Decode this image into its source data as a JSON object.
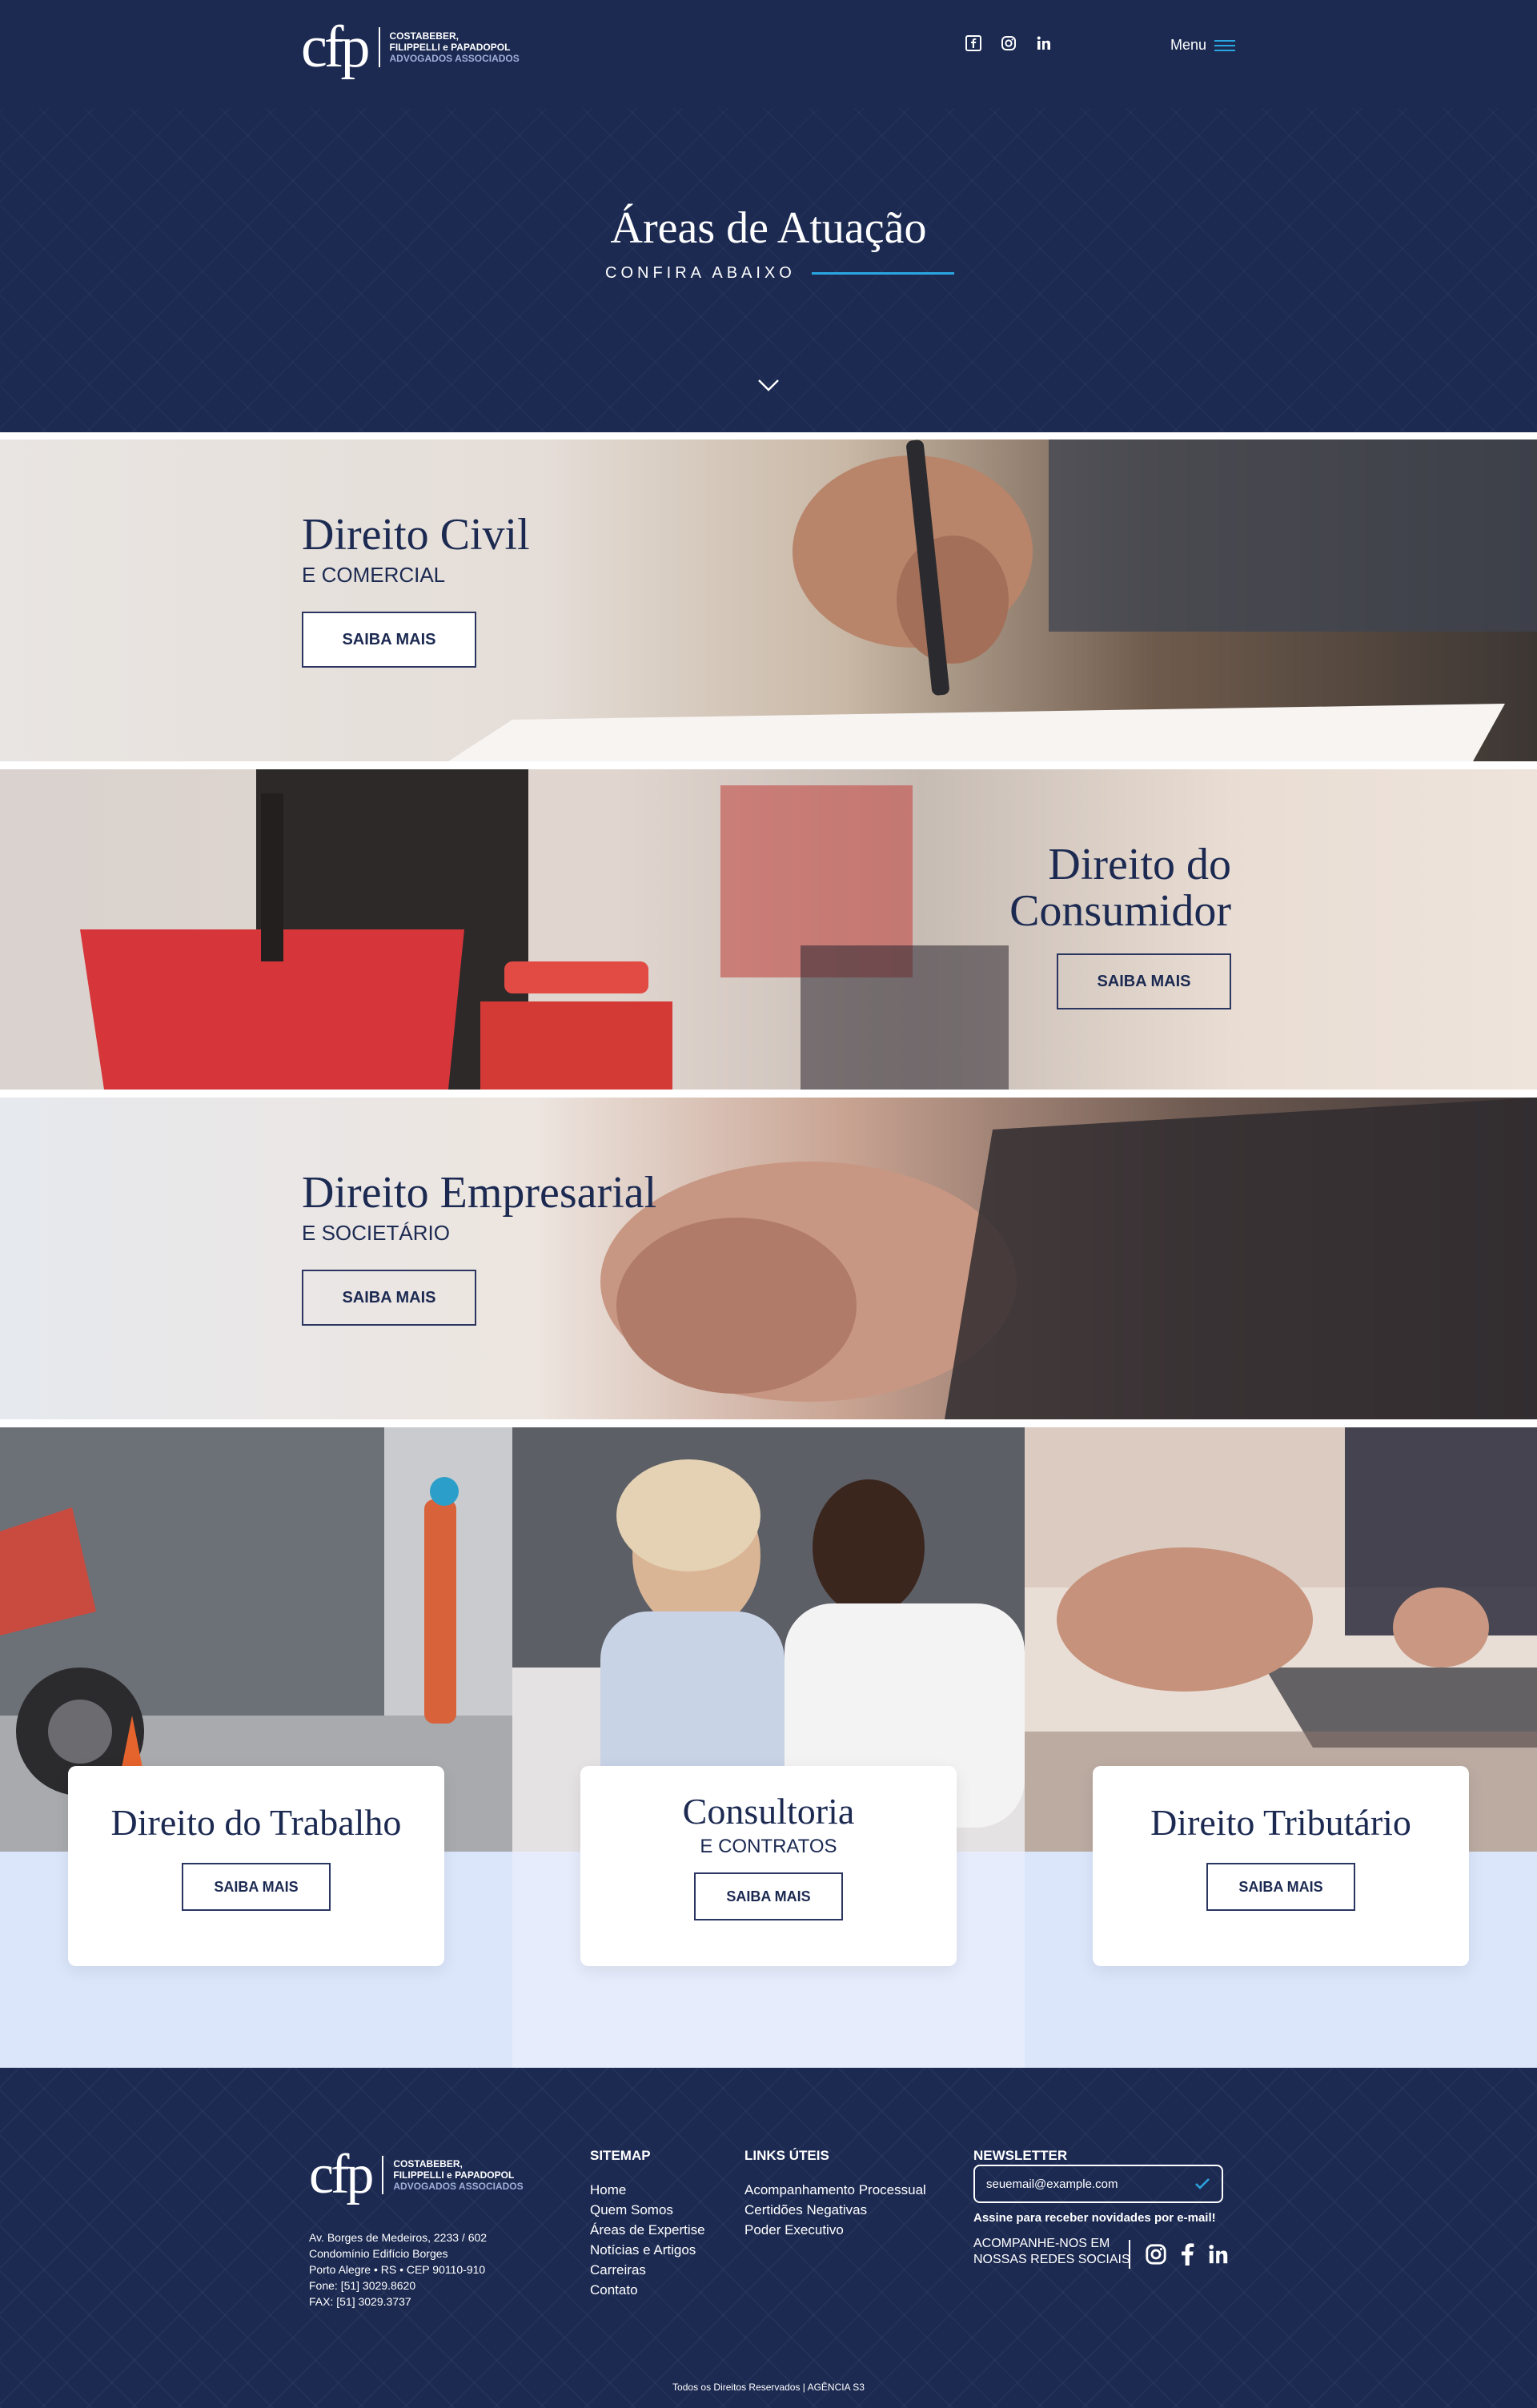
{
  "header": {
    "logo": {
      "mark": "cfp",
      "line1": "COSTABEBER,",
      "line2": "FILIPPELLI e PAPADOPOL",
      "line3": "ADVOGADOS ASSOCIADOS"
    },
    "social_icons": [
      "facebook-icon",
      "instagram-icon",
      "linkedin-icon"
    ],
    "menu_label": "Menu"
  },
  "hero": {
    "title": "Áreas de Atuação",
    "subtitle": "CONFIRA ABAIXO"
  },
  "banners": [
    {
      "title": "Direito Civil",
      "subtitle": "E COMERCIAL",
      "button": "SAIBA MAIS"
    },
    {
      "title_line1": "Direito do",
      "title_line2": "Consumidor",
      "button": "SAIBA MAIS"
    },
    {
      "title": "Direito Empresarial",
      "subtitle": "E SOCIETÁRIO",
      "button": "SAIBA MAIS"
    }
  ],
  "cards": [
    {
      "title": "Direito do Trabalho",
      "button": "SAIBA MAIS"
    },
    {
      "title": "Consultoria",
      "subtitle": "E CONTRATOS",
      "button": "SAIBA MAIS"
    },
    {
      "title": "Direito Tributário",
      "button": "SAIBA MAIS"
    }
  ],
  "footer": {
    "address": [
      "Av. Borges de Medeiros, 2233 / 602",
      "Condomínio Edifício Borges",
      "Porto Alegre • RS • CEP 90110-910",
      "Fone: [51] 3029.8620",
      "FAX: [51] 3029.3737"
    ],
    "sitemap": {
      "heading": "SITEMAP",
      "items": [
        "Home",
        "Quem Somos",
        "Áreas de Expertise",
        "Notícias e Artigos",
        "Carreiras",
        "Contato"
      ]
    },
    "links": {
      "heading": "LINKS ÚTEIS",
      "items": [
        "Acompanhamento Processual",
        "Certidões Negativas",
        "Poder Executivo"
      ]
    },
    "newsletter": {
      "heading": "NEWSLETTER",
      "placeholder": "seuemail@example.com",
      "note": "Assine para receber novidades por e-mail!"
    },
    "follow_line1": "ACOMPANHE-NOS EM",
    "follow_line2": "NOSSAS REDES SOCIAIS",
    "copyright": "Todos os Direitos Reservados | AGÊNCIA S3"
  },
  "colors": {
    "navy": "#1c2a52",
    "accent": "#2aa6e0",
    "light_blue": "#dbe6fb"
  }
}
